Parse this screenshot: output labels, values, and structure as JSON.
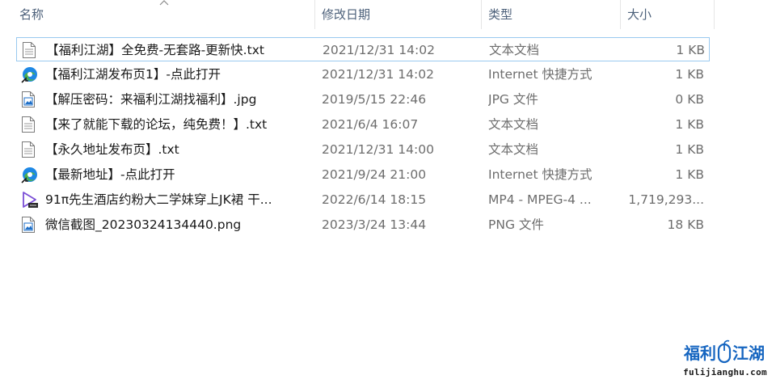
{
  "columns": {
    "name": "名称",
    "date": "修改日期",
    "type": "类型",
    "size": "大小"
  },
  "files": [
    {
      "icon": "text-file-icon",
      "name": "【福利江湖】全免费-无套路-更新快.txt",
      "date": "2021/12/31 14:02",
      "type": "文本文档",
      "size": "1 KB"
    },
    {
      "icon": "edge-shortcut-icon",
      "name": "【福利江湖发布页1】-点此打开",
      "date": "2021/12/31 14:02",
      "type": "Internet 快捷方式",
      "size": "1 KB"
    },
    {
      "icon": "image-file-icon",
      "name": "【解压密码：来福利江湖找福利】.jpg",
      "date": "2019/5/15 22:46",
      "type": "JPG 文件",
      "size": "0 KB"
    },
    {
      "icon": "text-file-icon",
      "name": "【来了就能下载的论坛，纯免费！】.txt",
      "date": "2021/6/4 16:07",
      "type": "文本文档",
      "size": "1 KB"
    },
    {
      "icon": "text-file-icon",
      "name": "【永久地址发布页】.txt",
      "date": "2021/12/31 14:00",
      "type": "文本文档",
      "size": "1 KB"
    },
    {
      "icon": "edge-shortcut-icon",
      "name": "【最新地址】-点此打开",
      "date": "2021/9/24 21:00",
      "type": "Internet 快捷方式",
      "size": "1 KB"
    },
    {
      "icon": "video-file-icon",
      "name": "91π先生酒店约粉大二学妹穿上JK裙 干...",
      "date": "2022/6/14 18:15",
      "type": "MP4 - MPEG-4 ...",
      "size": "1,719,293..."
    },
    {
      "icon": "image-file-icon",
      "name": "微信截图_20230324134440.png",
      "date": "2023/3/24 13:44",
      "type": "PNG 文件",
      "size": "18 KB"
    }
  ],
  "watermark": {
    "left_text": "福利",
    "right_text": "江湖",
    "url": "fulijianghu.com"
  },
  "colors": {
    "header_text": "#4c607a",
    "focus_border": "#99c9ef",
    "watermark_blue": "#1565c0"
  }
}
